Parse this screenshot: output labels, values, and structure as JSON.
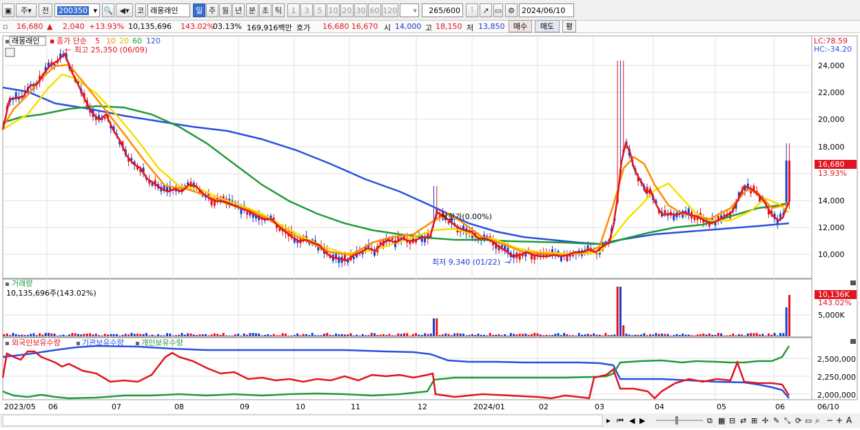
{
  "toolbar": {
    "market_label": "주",
    "prev_label": "전",
    "code": "200350",
    "code_prefix": "코",
    "stock_name": "래몽래인",
    "period_tabs": [
      "일",
      "주",
      "월",
      "년",
      "분",
      "초",
      "틱"
    ],
    "interval_buttons": [
      "1",
      "3",
      "5",
      "10",
      "20",
      "30",
      "60",
      "120"
    ],
    "count": "265",
    "count_total": "/600",
    "date": "2024/06/10"
  },
  "quote": {
    "price": "16,680",
    "change": "2,040",
    "change_pct": "+13.93%",
    "volume": "10,135,696",
    "volume_ratio": "143.02%",
    "turnover": "03.13%",
    "amount": "169,916백만",
    "bid_label": "호가",
    "ask_price": "16,680",
    "bid_price": "16,670",
    "open_label": "시",
    "open": "14,000",
    "high_label": "고",
    "high": "18,150",
    "low_label": "저",
    "low": "13,850",
    "buy_button": "매수",
    "sell_button": "매도",
    "eval_button": "평"
  },
  "price_panel": {
    "stock_tag": "래몽래인",
    "ma_label": "종가 단순",
    "ma_periods": [
      "5",
      "10",
      "20",
      "60",
      "120"
    ],
    "ma_colors": [
      "#e0141e",
      "#ff8c00",
      "#f5e000",
      "#1f9a3a",
      "#2a4fe0"
    ],
    "high_marker": "최고 25,350 (06/09)",
    "low_marker": "최저 9,340 (01/22)",
    "mid_marker": "상한가(0.00%)",
    "lc_label": "LC:78.59",
    "hc_label": "HC:-34.20",
    "current_price_label": "16,680",
    "current_pct_label": "13.93%",
    "y_ticks": [
      "24,000",
      "22,000",
      "20,000",
      "18,000",
      "14,000",
      "12,000",
      "10,000"
    ]
  },
  "volume_panel": {
    "title": "거래량",
    "volume_readout": "10,135,696주(143.02%)",
    "current_label": "10,136K",
    "current_pct": "143.02%",
    "y_tick": "5,000K"
  },
  "holdings_panel": {
    "series_labels": [
      "외국인보유수량",
      "기관보유수량",
      "개인보유수량"
    ],
    "series_colors": [
      "#e0141e",
      "#2a4fe0",
      "#1f9a3a"
    ],
    "y_ticks": [
      "2,500,000",
      "2,250,000",
      "2,000,000"
    ]
  },
  "x_axis": {
    "labels": [
      "2023/05",
      "06",
      "07",
      "08",
      "09",
      "10",
      "11",
      "12",
      "2024/01",
      "02",
      "03",
      "04",
      "05",
      "06",
      "06/10"
    ]
  }
}
